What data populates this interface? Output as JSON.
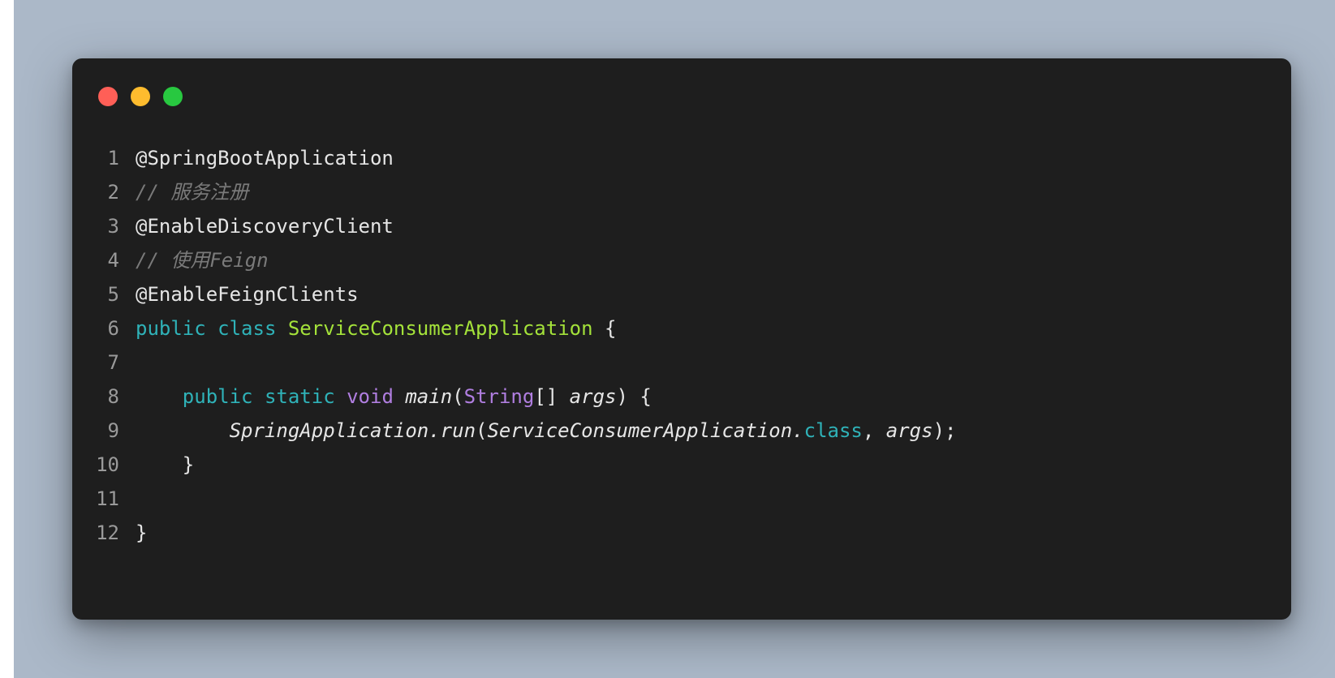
{
  "colors": {
    "background": "#abb8c8",
    "window": "#1e1e1e",
    "dot_close": "#ff5f57",
    "dot_minimize": "#febc2e",
    "dot_zoom": "#28c840",
    "line_number": "#9a9a9a",
    "keyword": "#2fb2b8",
    "type_keyword": "#b07ee0",
    "class_name": "#a4e23a",
    "comment": "#7a7a7a",
    "text": "#e6e6e6"
  },
  "window_controls": [
    "close",
    "minimize",
    "zoom"
  ],
  "code": {
    "lines": [
      {
        "n": "1",
        "tokens": [
          {
            "t": "@SpringBootApplication",
            "k": "ann"
          }
        ]
      },
      {
        "n": "2",
        "tokens": [
          {
            "t": "// 服务注册",
            "k": "comment"
          }
        ]
      },
      {
        "n": "3",
        "tokens": [
          {
            "t": "@EnableDiscoveryClient",
            "k": "ann"
          }
        ]
      },
      {
        "n": "4",
        "tokens": [
          {
            "t": "// 使用Feign",
            "k": "comment"
          }
        ]
      },
      {
        "n": "5",
        "tokens": [
          {
            "t": "@EnableFeignClients",
            "k": "ann"
          }
        ]
      },
      {
        "n": "6",
        "tokens": [
          {
            "t": "public",
            "k": "kw"
          },
          {
            "t": " ",
            "k": "punc"
          },
          {
            "t": "class",
            "k": "kw"
          },
          {
            "t": " ",
            "k": "punc"
          },
          {
            "t": "ServiceConsumerApplication",
            "k": "cls"
          },
          {
            "t": " {",
            "k": "punc"
          }
        ]
      },
      {
        "n": "7",
        "tokens": []
      },
      {
        "n": "8",
        "tokens": [
          {
            "t": "    ",
            "k": "punc"
          },
          {
            "t": "public",
            "k": "kw"
          },
          {
            "t": " ",
            "k": "punc"
          },
          {
            "t": "static",
            "k": "kw"
          },
          {
            "t": " ",
            "k": "punc"
          },
          {
            "t": "void",
            "k": "kw2"
          },
          {
            "t": " ",
            "k": "punc"
          },
          {
            "t": "main",
            "k": "ital"
          },
          {
            "t": "(",
            "k": "punc"
          },
          {
            "t": "String",
            "k": "kw2"
          },
          {
            "t": "[] ",
            "k": "punc"
          },
          {
            "t": "args",
            "k": "ital"
          },
          {
            "t": ") {",
            "k": "punc"
          }
        ]
      },
      {
        "n": "9",
        "tokens": [
          {
            "t": "        ",
            "k": "punc"
          },
          {
            "t": "SpringApplication.run",
            "k": "ital"
          },
          {
            "t": "(",
            "k": "punc"
          },
          {
            "t": "ServiceConsumerApplication.",
            "k": "ital"
          },
          {
            "t": "class",
            "k": "kw"
          },
          {
            "t": ", ",
            "k": "punc"
          },
          {
            "t": "args",
            "k": "ital"
          },
          {
            "t": ");",
            "k": "punc"
          }
        ]
      },
      {
        "n": "10",
        "tokens": [
          {
            "t": "    }",
            "k": "punc"
          }
        ]
      },
      {
        "n": "11",
        "tokens": []
      },
      {
        "n": "12",
        "tokens": [
          {
            "t": "}",
            "k": "punc"
          }
        ]
      }
    ]
  }
}
